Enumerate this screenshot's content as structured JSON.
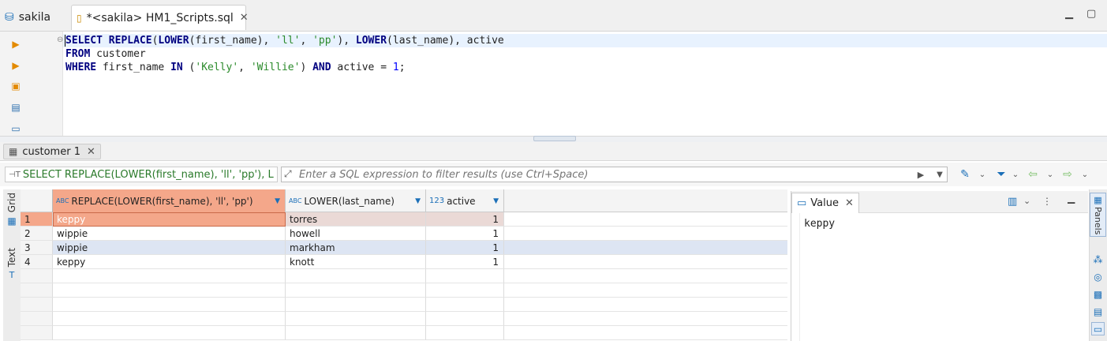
{
  "tabs": [
    {
      "label": "sakila",
      "icon": "database-icon"
    },
    {
      "label": "*<sakila> HM1_Scripts.sql",
      "icon": "sql-script-icon",
      "close": "✕"
    }
  ],
  "editor": {
    "lines": [
      [
        {
          "t": "SELECT ",
          "c": "kw"
        },
        {
          "t": "REPLACE",
          "c": "kw"
        },
        {
          "t": "(",
          "c": ""
        },
        {
          "t": "LOWER",
          "c": "kw"
        },
        {
          "t": "(first_name), ",
          "c": ""
        },
        {
          "t": "'ll'",
          "c": "st"
        },
        {
          "t": ", ",
          "c": ""
        },
        {
          "t": "'pp'",
          "c": "st"
        },
        {
          "t": "), ",
          "c": ""
        },
        {
          "t": "LOWER",
          "c": "kw"
        },
        {
          "t": "(last_name), active",
          "c": ""
        }
      ],
      [
        {
          "t": "FROM ",
          "c": "kw"
        },
        {
          "t": "customer",
          "c": ""
        }
      ],
      [
        {
          "t": "WHERE ",
          "c": "kw"
        },
        {
          "t": "first_name ",
          "c": ""
        },
        {
          "t": "IN ",
          "c": "kw"
        },
        {
          "t": "(",
          "c": ""
        },
        {
          "t": "'Kelly'",
          "c": "st"
        },
        {
          "t": ", ",
          "c": ""
        },
        {
          "t": "'Willie'",
          "c": "st"
        },
        {
          "t": ") ",
          "c": ""
        },
        {
          "t": "AND ",
          "c": "kw"
        },
        {
          "t": "active = ",
          "c": ""
        },
        {
          "t": "1",
          "c": "nm"
        },
        {
          "t": ";",
          "c": ""
        }
      ]
    ]
  },
  "results": {
    "tab_label": "customer 1",
    "tab_close": "✕",
    "sql_snippet": "SELECT REPLACE(LOWER(first_name), 'll', 'pp'), L",
    "filter_placeholder": "Enter a SQL expression to filter results (use Ctrl+Space)",
    "side_tabs": [
      "Grid",
      "Text"
    ],
    "columns": [
      {
        "label": "REPLACE(LOWER(first_name), 'll', 'pp')",
        "type_icon": "ABC"
      },
      {
        "label": "LOWER(last_name)",
        "type_icon": "ABC"
      },
      {
        "label": "active",
        "type_icon": "123"
      }
    ],
    "rows": [
      {
        "n": "1",
        "c1": "keppy",
        "c2": "torres",
        "c3": "1"
      },
      {
        "n": "2",
        "c1": "wippie",
        "c2": "howell",
        "c3": "1"
      },
      {
        "n": "3",
        "c1": "wippie",
        "c2": "markham",
        "c3": "1"
      },
      {
        "n": "4",
        "c1": "keppy",
        "c2": "knott",
        "c3": "1"
      }
    ]
  },
  "value_panel": {
    "tab_label": "Value",
    "tab_close": "✕",
    "value": "keppy",
    "panels_label": "Panels"
  },
  "colors": {
    "accent": "#1b6fb8",
    "selected_cell": "#f4a78a",
    "row_highlight": "#dde5f3",
    "keyword": "#000080",
    "string": "#2a8a2a"
  }
}
